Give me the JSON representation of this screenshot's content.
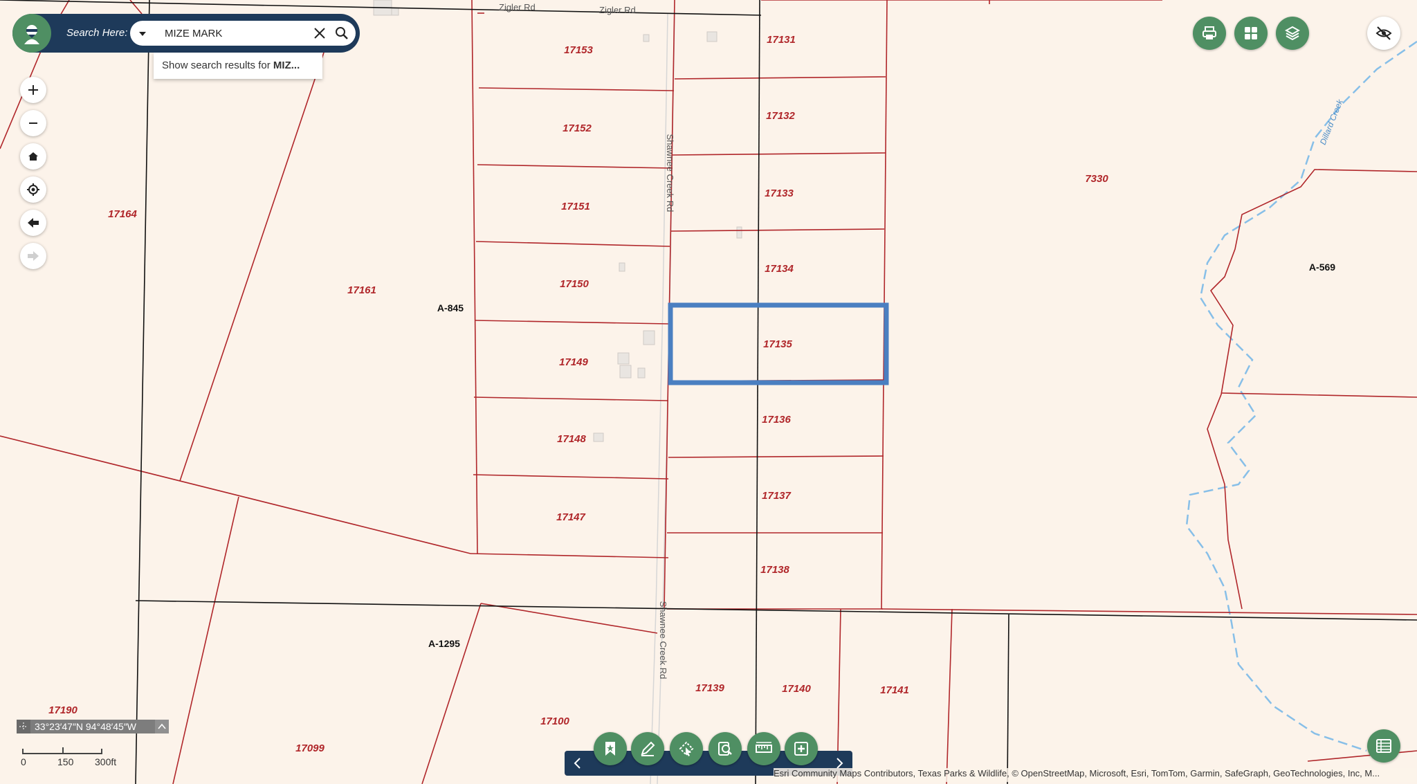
{
  "search": {
    "label": "Search Here:",
    "value": "MIZE MARK",
    "suggestion_prefix": "Show search results for ",
    "suggestion_term": "MIZ..."
  },
  "map": {
    "roads": [
      "Zigler Rd",
      "Zigler Rd",
      "Shawnee Creek Rd",
      "Shawnee Creek Rd"
    ],
    "creek": "Dillard Creek",
    "abstracts": [
      "A-845",
      "A-569",
      "A-1295"
    ],
    "parcels": [
      "17153",
      "17152",
      "17151",
      "17150",
      "17149",
      "17148",
      "17147",
      "17131",
      "17132",
      "17133",
      "17134",
      "17135",
      "17136",
      "17137",
      "17138",
      "7330",
      "17164",
      "17161",
      "17139",
      "17140",
      "17141",
      "17190",
      "17100",
      "17099"
    ],
    "selected_parcel": "17135"
  },
  "coordinates": "33°23′47″N 94°48′45″W",
  "scale": {
    "labels": [
      "0",
      "150",
      "300ft"
    ]
  },
  "attribution": "Esri Community Maps Contributors, Texas Parks & Wildlife, © OpenStreetMap, Microsoft, Esri, TomTom, Garmin, SafeGraph, GeoTechnologies, Inc, M...",
  "colors": {
    "parcel_line": "#b0262a",
    "abstract_line": "#111111",
    "selection": "#4a7fc1",
    "creek": "#87bfe8",
    "panel_bg": "#1e3a5a",
    "button_green": "#4f8f63",
    "map_bg": "#fcf3ea"
  }
}
